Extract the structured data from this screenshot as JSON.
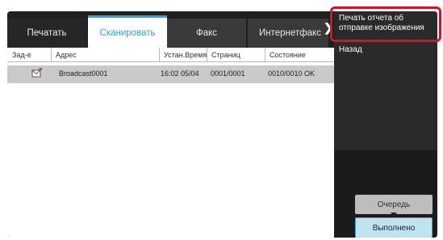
{
  "tabs": [
    {
      "label": "Печатать"
    },
    {
      "label": "Сканировать"
    },
    {
      "label": "Факс"
    },
    {
      "label": "Интернетфакс"
    }
  ],
  "table": {
    "headers": [
      "Зад-е",
      "Адрес",
      "Устан.Время",
      "Страниц",
      "Состояние"
    ],
    "rows": [
      {
        "icon": "envelope-send-icon",
        "address": "Broadcast0001",
        "time": "16:02 05/04",
        "pages": "0001/0001",
        "state": "0010/0010 OK"
      }
    ]
  },
  "menu": {
    "items": [
      {
        "label": "Печать отчета об отправке изображения"
      },
      {
        "label": "Назад"
      }
    ]
  },
  "buttons": {
    "queue": "Очередь",
    "done": "Выполнено"
  },
  "colors": {
    "accent": "#2ea3d6",
    "highlight": "#d3122b",
    "done_bg": "#bfe3ef"
  }
}
